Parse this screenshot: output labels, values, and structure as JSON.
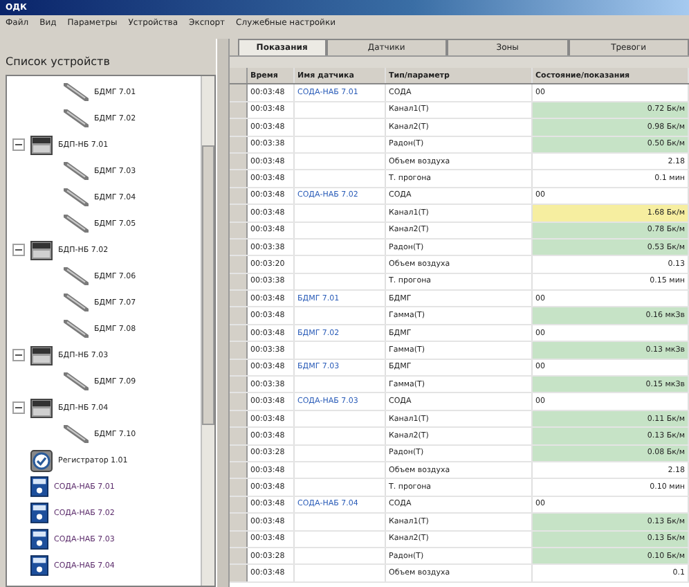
{
  "window": {
    "title": "ОДК"
  },
  "menu": [
    "Файл",
    "Вид",
    "Параметры",
    "Устройства",
    "Экспорт",
    "Служебные настройки"
  ],
  "sidebar": {
    "title": "Список устройств",
    "continued_items": [
      {
        "label": "БДМГ 7.01",
        "kind": "sensor"
      },
      {
        "label": "БДМГ 7.02",
        "kind": "sensor"
      }
    ],
    "items": [
      {
        "label": "БДП-НБ 7.01",
        "kind": "block",
        "expanded": true,
        "children": [
          {
            "label": "БДМГ 7.03",
            "kind": "sensor"
          },
          {
            "label": "БДМГ 7.04",
            "kind": "sensor"
          },
          {
            "label": "БДМГ 7.05",
            "kind": "sensor"
          }
        ]
      },
      {
        "label": "БДП-НБ 7.02",
        "kind": "block",
        "expanded": true,
        "children": [
          {
            "label": "БДМГ 7.06",
            "kind": "sensor"
          },
          {
            "label": "БДМГ 7.07",
            "kind": "sensor"
          },
          {
            "label": "БДМГ 7.08",
            "kind": "sensor"
          }
        ]
      },
      {
        "label": "БДП-НБ 7.03",
        "kind": "block",
        "expanded": true,
        "children": [
          {
            "label": "БДМГ 7.09",
            "kind": "sensor"
          }
        ]
      },
      {
        "label": "БДП-НБ 7.04",
        "kind": "block",
        "expanded": true,
        "children": [
          {
            "label": "БДМГ 7.10",
            "kind": "sensor"
          }
        ]
      },
      {
        "label": "Регистратор 1.01",
        "kind": "recorder"
      },
      {
        "label": "СОДА-НАБ 7.01",
        "kind": "monitor"
      },
      {
        "label": "СОДА-НАБ 7.02",
        "kind": "monitor"
      },
      {
        "label": "СОДА-НАБ 7.03",
        "kind": "monitor"
      },
      {
        "label": "СОДА-НАБ 7.04",
        "kind": "monitor"
      }
    ]
  },
  "tabs": [
    {
      "label": "Показания",
      "selected": true
    },
    {
      "label": "Датчики",
      "selected": false
    },
    {
      "label": "Зоны",
      "selected": false
    },
    {
      "label": "Тревоги",
      "selected": false
    }
  ],
  "table": {
    "columns": [
      "Время",
      "Имя датчика",
      "Тип/параметр",
      "Состояние/показания"
    ],
    "rows": [
      {
        "time": "00:03:48",
        "sensor": "СОДА-НАБ 7.01",
        "param": "СОДА",
        "value": "00"
      },
      {
        "time": "00:03:48",
        "param": "Канал1(Т)",
        "value": "0.72 Бк/м",
        "color": "#c6e3c6"
      },
      {
        "time": "00:03:48",
        "param": "Канал2(Т)",
        "value": "0.98 Бк/м",
        "color": "#c6e3c6"
      },
      {
        "time": "00:03:38",
        "param": "Радон(Т)",
        "value": "0.50 Бк/м",
        "color": "#c6e3c6"
      },
      {
        "time": "00:03:48",
        "param": "Объем воздуха",
        "value": "2.18"
      },
      {
        "time": "00:03:48",
        "param": "Т. прогона",
        "value": "0.1 мин"
      },
      {
        "time": "00:03:48",
        "sensor": "СОДА-НАБ 7.02",
        "param": "СОДА",
        "value": "00"
      },
      {
        "time": "00:03:48",
        "param": "Канал1(Т)",
        "value": "1.68 Бк/м",
        "color": "#f6eea0"
      },
      {
        "time": "00:03:48",
        "param": "Канал2(Т)",
        "value": "0.78 Бк/м",
        "color": "#c6e3c6"
      },
      {
        "time": "00:03:38",
        "param": "Радон(Т)",
        "value": "0.53 Бк/м",
        "color": "#c6e3c6"
      },
      {
        "time": "00:03:20",
        "param": "Объем воздуха",
        "value": "0.13"
      },
      {
        "time": "00:03:38",
        "param": "Т. прогона",
        "value": "0.15 мин"
      },
      {
        "time": "00:03:48",
        "sensor": "БДМГ 7.01",
        "param": "БДМГ",
        "value": "00"
      },
      {
        "time": "00:03:48",
        "param": "Гамма(Т)",
        "value": "0.16 мкЗв",
        "color": "#c6e3c6"
      },
      {
        "time": "00:03:48",
        "sensor": "БДМГ 7.02",
        "param": "БДМГ",
        "value": "00"
      },
      {
        "time": "00:03:38",
        "param": "Гамма(Т)",
        "value": "0.13 мкЗв",
        "color": "#c6e3c6"
      },
      {
        "time": "00:03:48",
        "sensor": "БДМГ 7.03",
        "param": "БДМГ",
        "value": "00"
      },
      {
        "time": "00:03:38",
        "param": "Гамма(Т)",
        "value": "0.15 мкЗв",
        "color": "#c6e3c6"
      },
      {
        "time": "00:03:48",
        "sensor": "СОДА-НАБ 7.03",
        "param": "СОДА",
        "value": "00"
      },
      {
        "time": "00:03:48",
        "param": "Канал1(Т)",
        "value": "0.11 Бк/м",
        "color": "#c6e3c6"
      },
      {
        "time": "00:03:48",
        "param": "Канал2(Т)",
        "value": "0.13 Бк/м",
        "color": "#c6e3c6"
      },
      {
        "time": "00:03:28",
        "param": "Радон(Т)",
        "value": "0.08 Бк/м",
        "color": "#c6e3c6"
      },
      {
        "time": "00:03:48",
        "param": "Объем воздуха",
        "value": "2.18"
      },
      {
        "time": "00:03:48",
        "param": "Т. прогона",
        "value": "0.10 мин"
      },
      {
        "time": "00:03:48",
        "sensor": "СОДА-НАБ 7.04",
        "param": "СОДА",
        "value": "00"
      },
      {
        "time": "00:03:48",
        "param": "Канал1(Т)",
        "value": "0.13 Бк/м",
        "color": "#c6e3c6"
      },
      {
        "time": "00:03:48",
        "param": "Канал2(Т)",
        "value": "0.13 Бк/м",
        "color": "#c6e3c6"
      },
      {
        "time": "00:03:28",
        "param": "Радон(Т)",
        "value": "0.10 Бк/м",
        "color": "#c6e3c6"
      },
      {
        "time": "00:03:48",
        "param": "Объем воздуха",
        "value": "0.1"
      }
    ]
  }
}
